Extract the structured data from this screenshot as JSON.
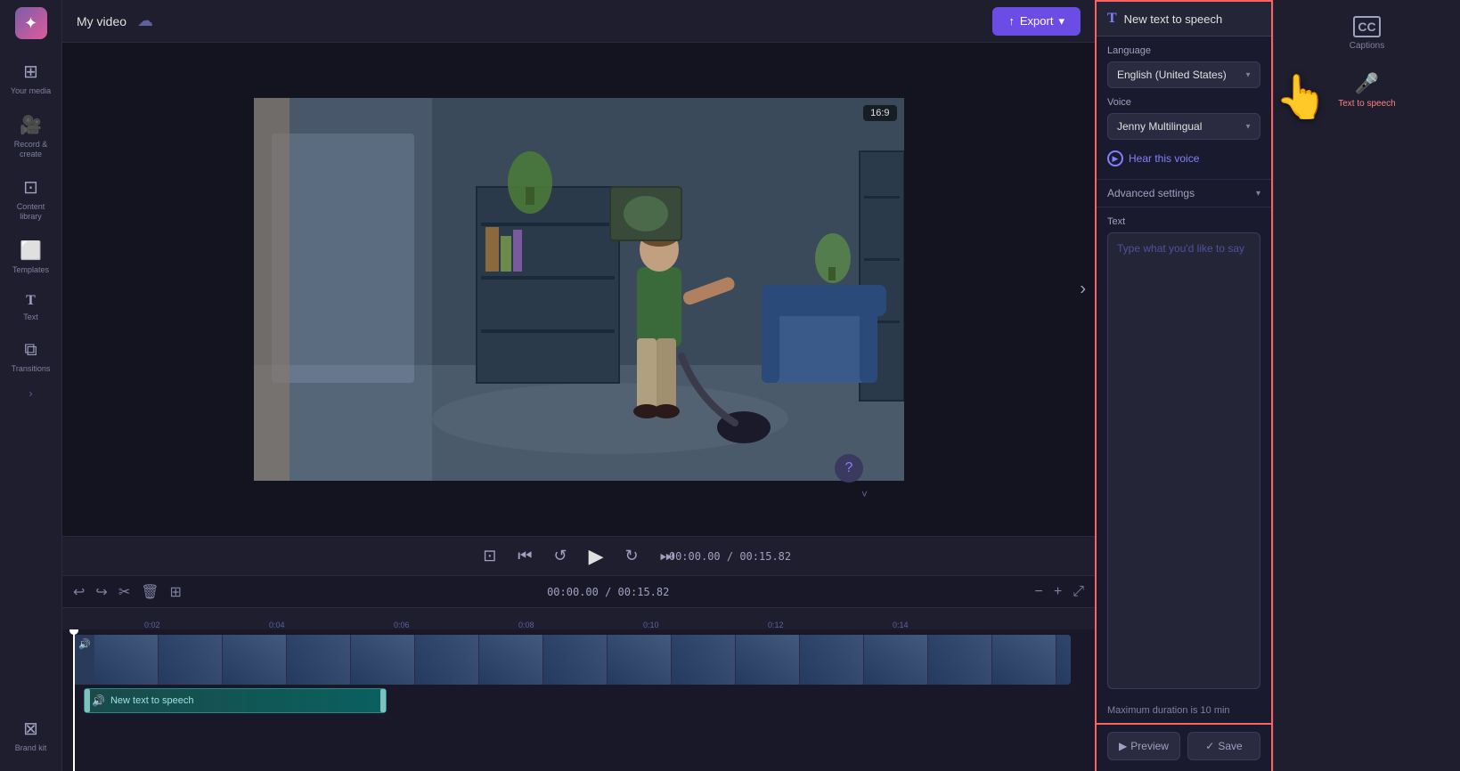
{
  "app": {
    "title": "My video",
    "logo_icon": "✦"
  },
  "topbar": {
    "title": "My video",
    "export_label": "Export"
  },
  "sidebar": {
    "items": [
      {
        "id": "your-media",
        "icon": "⊞",
        "label": "Your media"
      },
      {
        "id": "record-create",
        "icon": "🎥",
        "label": "Record & create"
      },
      {
        "id": "content-library",
        "icon": "⊡",
        "label": "Content library"
      },
      {
        "id": "templates",
        "icon": "⬜",
        "label": "Templates"
      },
      {
        "id": "text",
        "icon": "T",
        "label": "Text"
      },
      {
        "id": "transitions",
        "icon": "⧉",
        "label": "Transitions"
      },
      {
        "id": "brand-kit",
        "icon": "⊠",
        "label": "Brand kit"
      }
    ]
  },
  "right_panel": {
    "items": [
      {
        "id": "captions",
        "icon": "CC",
        "label": "Captions"
      },
      {
        "id": "text-to-speech",
        "icon": "🎤",
        "label": "Text to speech",
        "active": true
      }
    ]
  },
  "video": {
    "aspect_ratio": "16:9",
    "nav_arrow_right": "›"
  },
  "playback": {
    "current_time": "00:00.00",
    "total_time": "00:15.82",
    "time_display": "00:00.00 / 00:15.82"
  },
  "timeline": {
    "ruler_marks": [
      "0:02",
      "0:04",
      "0:06",
      "0:08",
      "0:10",
      "0:12",
      "0:14"
    ],
    "tracks": [
      {
        "id": "video-track",
        "type": "video",
        "thumbs": 16
      },
      {
        "id": "audio-track",
        "type": "audio",
        "label": "New text to speech",
        "icon": "🔊"
      }
    ]
  },
  "tts_panel": {
    "header_icon": "T",
    "header_title": "New text to speech",
    "language_label": "Language",
    "language_value": "English (United States)",
    "voice_label": "Voice",
    "voice_value": "Jenny Multilingual",
    "hear_voice_label": "Hear this voice",
    "advanced_settings_label": "Advanced settings",
    "text_label": "Text",
    "text_placeholder": "Type what you'd like to say",
    "max_duration_text": "Maximum duration is 10 min",
    "preview_label": "Preview",
    "save_label": "Save",
    "preview_icon": "▶",
    "save_icon": "✓"
  },
  "timeline_controls": {
    "undo_label": "↩",
    "redo_label": "↪",
    "cut_label": "✂",
    "delete_label": "🗑",
    "save_alt_label": "💾",
    "zoom_out_label": "−",
    "zoom_in_label": "+",
    "expand_label": "⤢"
  }
}
